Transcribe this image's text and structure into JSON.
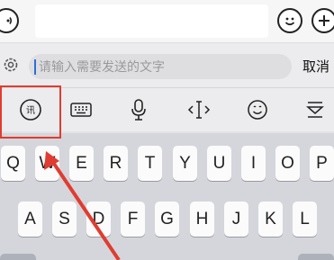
{
  "chat_bar": {
    "input_value": "",
    "voice_icon": "voice-icon",
    "emoji_icon": "emoji-icon",
    "plus_icon": "plus-icon"
  },
  "ime_bar": {
    "placeholder": "请输入需要发送的文字",
    "cancel_label": "取消",
    "settings_icon": "gear-icon"
  },
  "toolbar": {
    "items": [
      {
        "icon": "handwriting-icon",
        "label": "讯"
      },
      {
        "icon": "keyboard-icon"
      },
      {
        "icon": "microphone-icon"
      },
      {
        "icon": "cursor-icon"
      },
      {
        "icon": "emoji-icon"
      },
      {
        "icon": "collapse-keyboard-icon"
      }
    ]
  },
  "annotation": {
    "color": "#e03c31"
  },
  "keyboard": {
    "row1": [
      "Q",
      "W",
      "E",
      "R",
      "T",
      "Y",
      "U",
      "I",
      "O",
      "P"
    ],
    "row2": [
      "A",
      "S",
      "D",
      "F",
      "G",
      "H",
      "J",
      "K",
      "L"
    ]
  }
}
